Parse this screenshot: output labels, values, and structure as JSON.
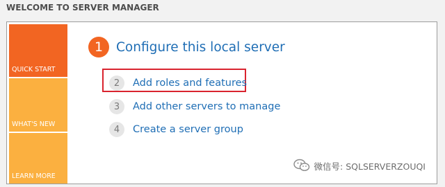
{
  "header": {
    "title": "WELCOME TO SERVER MANAGER"
  },
  "sidebar": {
    "items": [
      {
        "label": "QUICK START",
        "active": true
      },
      {
        "label": "WHAT'S NEW",
        "active": false
      },
      {
        "label": "LEARN MORE",
        "active": false
      }
    ]
  },
  "steps": {
    "main": {
      "number": "1",
      "label": "Configure this local server"
    },
    "items": [
      {
        "number": "2",
        "label": "Add roles and features",
        "highlighted": true
      },
      {
        "number": "3",
        "label": "Add other servers to manage",
        "highlighted": false
      },
      {
        "number": "4",
        "label": "Create a server group",
        "highlighted": false
      }
    ]
  },
  "watermark": {
    "text": "微信号: SQLSERVERZOUQI",
    "icon": "wechat-icon"
  },
  "colors": {
    "accent_orange": "#f26522",
    "tile_yellow": "#fbb040",
    "link_blue": "#1f6eb5",
    "highlight_red": "#d9232e"
  }
}
